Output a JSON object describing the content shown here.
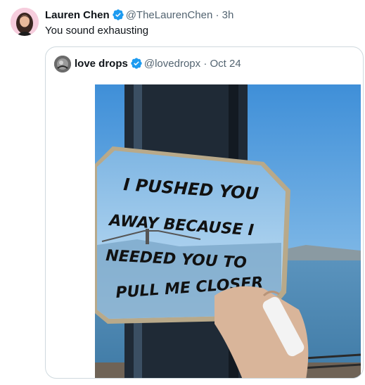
{
  "tweet": {
    "author_name": "Lauren Chen",
    "author_handle": "@TheLaurenChen",
    "separator": "·",
    "time": "3h",
    "text": "You sound exhausting"
  },
  "quoted": {
    "author_name": "love drops",
    "author_handle": "@lovedropx",
    "separator": "·",
    "date": "Oct 24",
    "image_text_lines": [
      "I PUSHED YOU",
      "AWAY BECAUSE I",
      "NEEDED YOU TO",
      "PULL ME CLOSER"
    ]
  },
  "colors": {
    "verified": "#1d9bf0",
    "muted": "#536471",
    "border": "#cfd9de",
    "sky": "#6fb0e0",
    "water": "#4c87b1"
  },
  "icons": {
    "verified": "verified-badge-icon"
  }
}
